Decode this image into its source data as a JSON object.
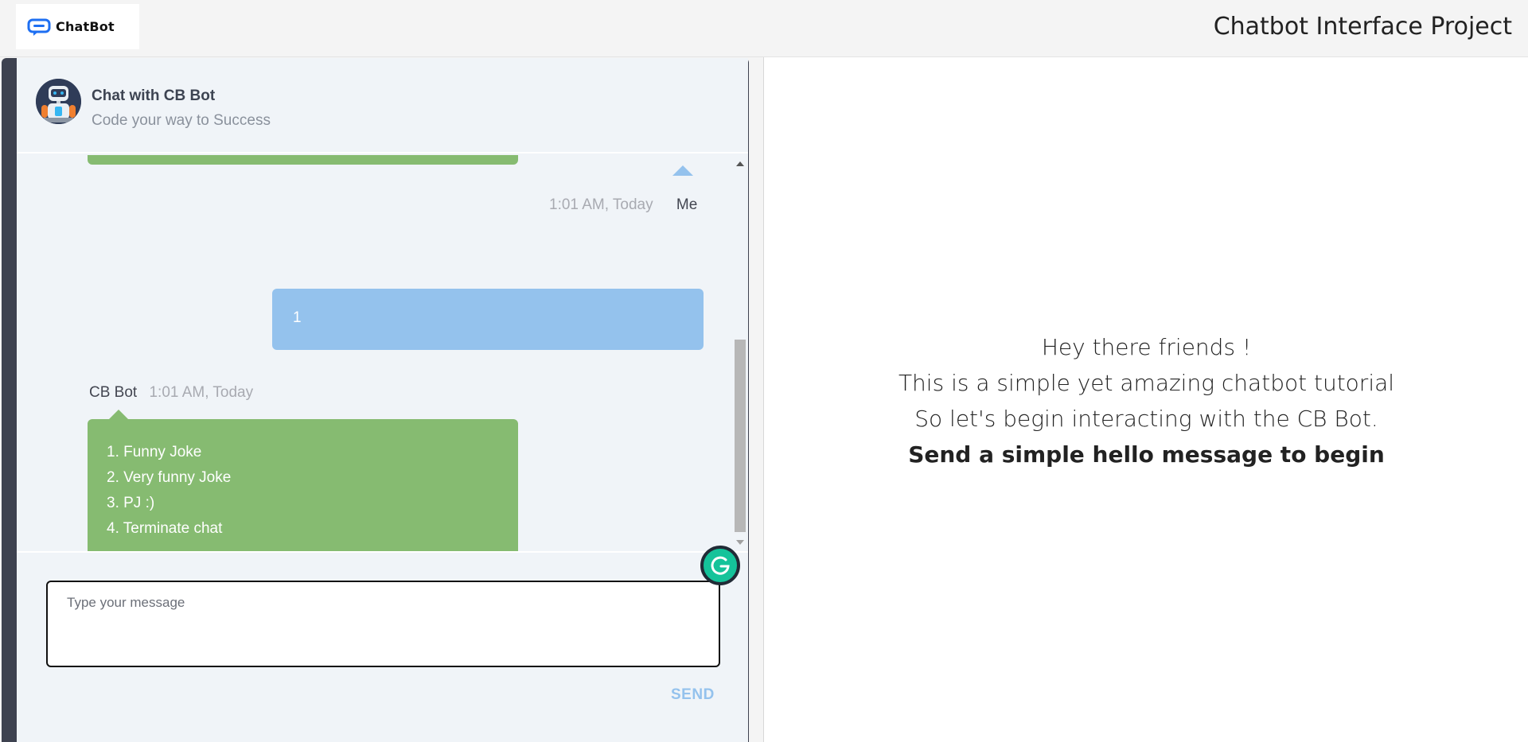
{
  "app": {
    "logo_text": "ChatBot",
    "project_title": "Chatbot Interface Project"
  },
  "chat": {
    "header": {
      "title": "Chat with CB Bot",
      "subtitle": "Code your way to Success"
    },
    "messages": [
      {
        "sender": "Me",
        "time": "1:01 AM, Today",
        "text": "1"
      },
      {
        "sender": "CB Bot",
        "time": "1:01 AM, Today",
        "items": [
          "1. Funny Joke",
          "2. Very funny Joke",
          "3. PJ :)",
          "4. Terminate chat"
        ]
      }
    ],
    "input": {
      "placeholder": "Type your message",
      "value": ""
    },
    "send_label": "SEND"
  },
  "intro": {
    "line1": "Hey there friends !",
    "line2": "This is a simple yet amazing chatbot tutorial",
    "line3": "So let's begin interacting with the CB Bot.",
    "line4": "Send a simple hello message to begin"
  },
  "colors": {
    "bot_bubble": "#86bb71",
    "user_bubble": "#94c2ed",
    "chat_bg": "#f0f4f8",
    "shell": "#3e4250",
    "grammarly": "#15c39a"
  },
  "icons": [
    "chatbot-logo-icon",
    "robot-avatar-icon",
    "grammarly-icon",
    "scroll-up-arrow-icon",
    "scroll-down-arrow-icon"
  ]
}
